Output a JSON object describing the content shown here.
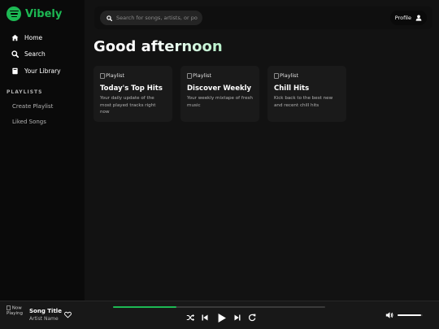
{
  "app": {
    "name": "Vibely",
    "brand_color": "#1db954"
  },
  "sidebar": {
    "nav": [
      {
        "label": "Home",
        "icon": "home-icon"
      },
      {
        "label": "Search",
        "icon": "search-icon"
      },
      {
        "label": "Your Library",
        "icon": "library-icon"
      }
    ],
    "section_title": "PLAYLISTS",
    "links": [
      {
        "label": "Create Playlist"
      },
      {
        "label": "Liked Songs"
      }
    ]
  },
  "header": {
    "search_placeholder": "Search for songs, artists, or podcasts",
    "profile_label": "Profile"
  },
  "main": {
    "greeting": "Good afternoon",
    "cards": [
      {
        "image_alt": "Playlist",
        "title": "Today's Top Hits",
        "description": "Your daily update of the most played tracks right now"
      },
      {
        "image_alt": "Playlist",
        "title": "Discover Weekly",
        "description": "Your weekly mixtape of fresh music"
      },
      {
        "image_alt": "Playlist",
        "title": "Chill Hits",
        "description": "Kick back to the best new and recent chill hits"
      }
    ]
  },
  "player": {
    "art_alt": "Now Playing",
    "song_title": "Song Title",
    "artist_name": "Artist Name",
    "progress_fraction": 0.3,
    "volume_fraction": 0.95
  }
}
